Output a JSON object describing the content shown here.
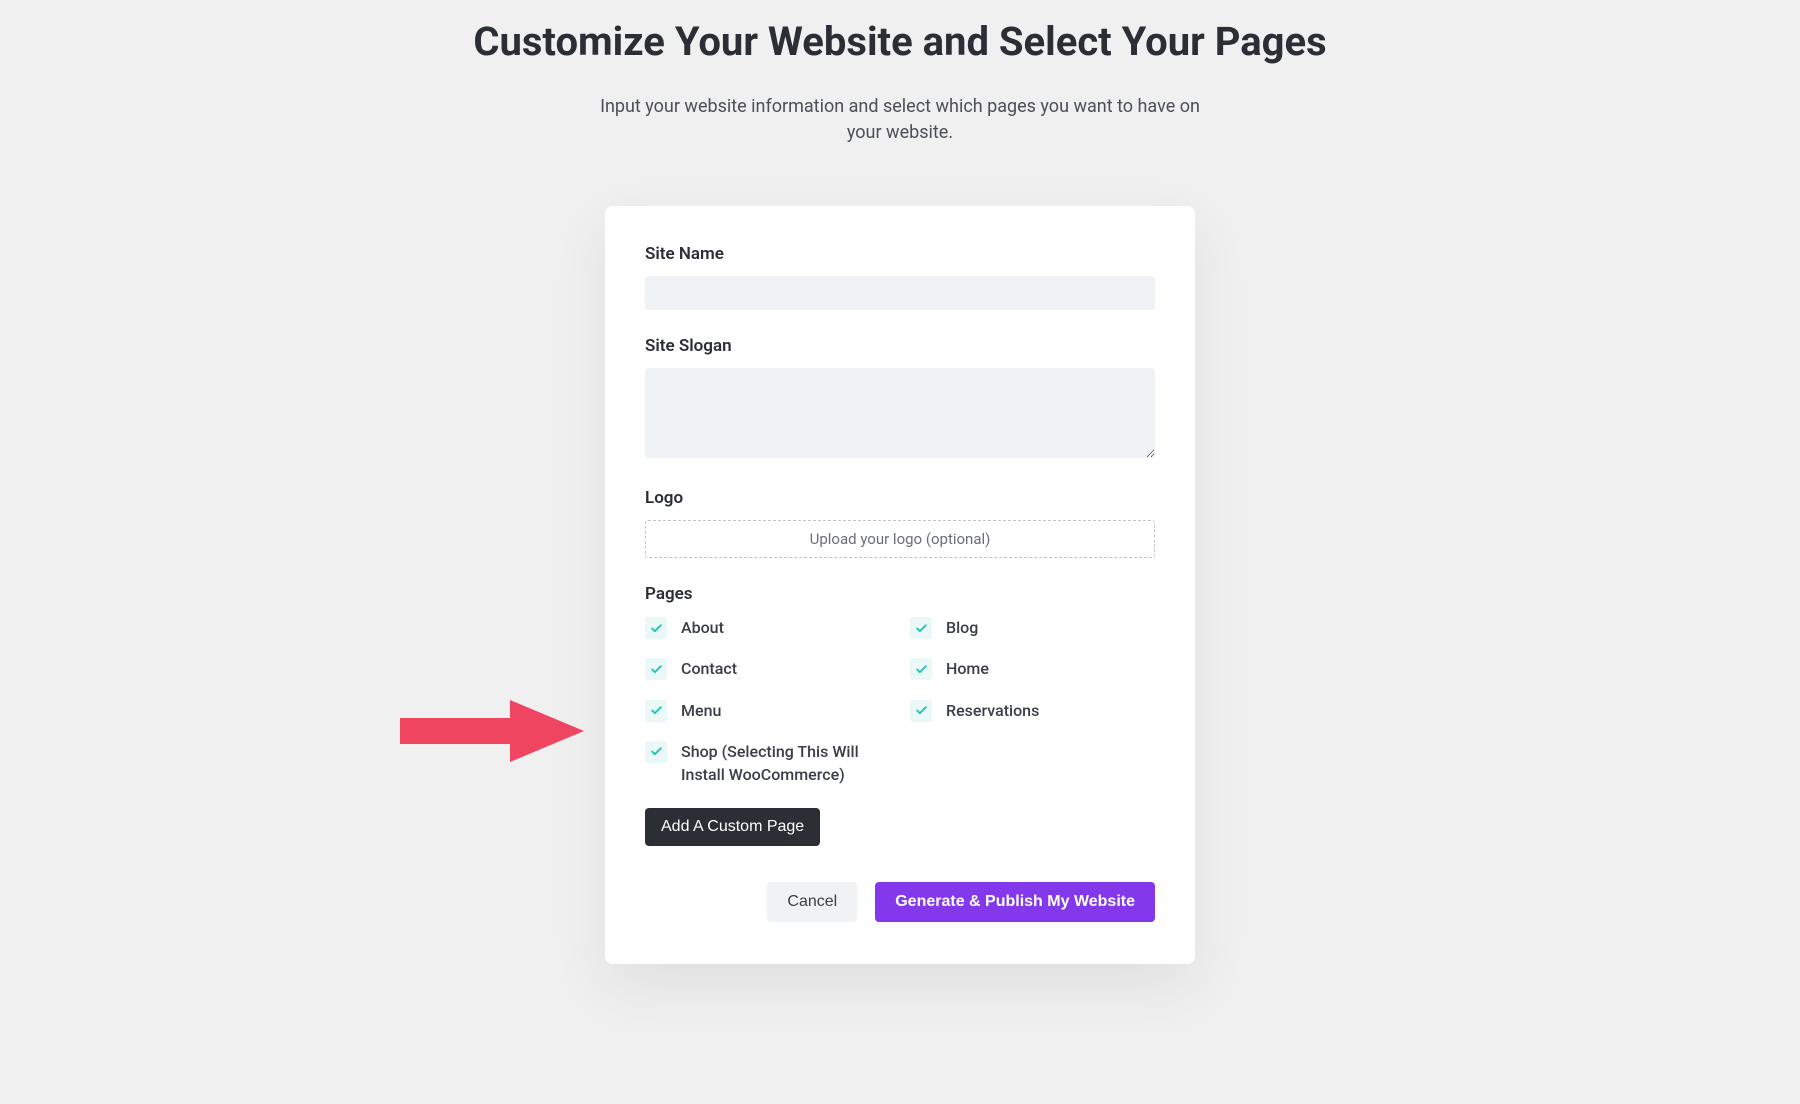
{
  "header": {
    "title": "Customize Your Website and Select Your Pages",
    "subtitle": "Input your website information and select which pages you want to have on your website."
  },
  "form": {
    "site_name_label": "Site Name",
    "site_name_value": "",
    "site_slogan_label": "Site Slogan",
    "site_slogan_value": "",
    "logo_label": "Logo",
    "logo_upload_text": "Upload your logo (optional)",
    "pages_label": "Pages",
    "pages": [
      {
        "label": "About",
        "checked": true
      },
      {
        "label": "Blog",
        "checked": true
      },
      {
        "label": "Contact",
        "checked": true
      },
      {
        "label": "Home",
        "checked": true
      },
      {
        "label": "Menu",
        "checked": true
      },
      {
        "label": "Reservations",
        "checked": true
      },
      {
        "label": "Shop (Selecting This Will Install WooCommerce)",
        "checked": true
      }
    ],
    "add_custom_label": "Add A Custom Page"
  },
  "footer": {
    "cancel_label": "Cancel",
    "generate_label": "Generate & Publish My Website"
  },
  "colors": {
    "accent_teal": "#1fc3b5",
    "accent_purple": "#8338ec",
    "arrow_red": "#ef4560"
  }
}
